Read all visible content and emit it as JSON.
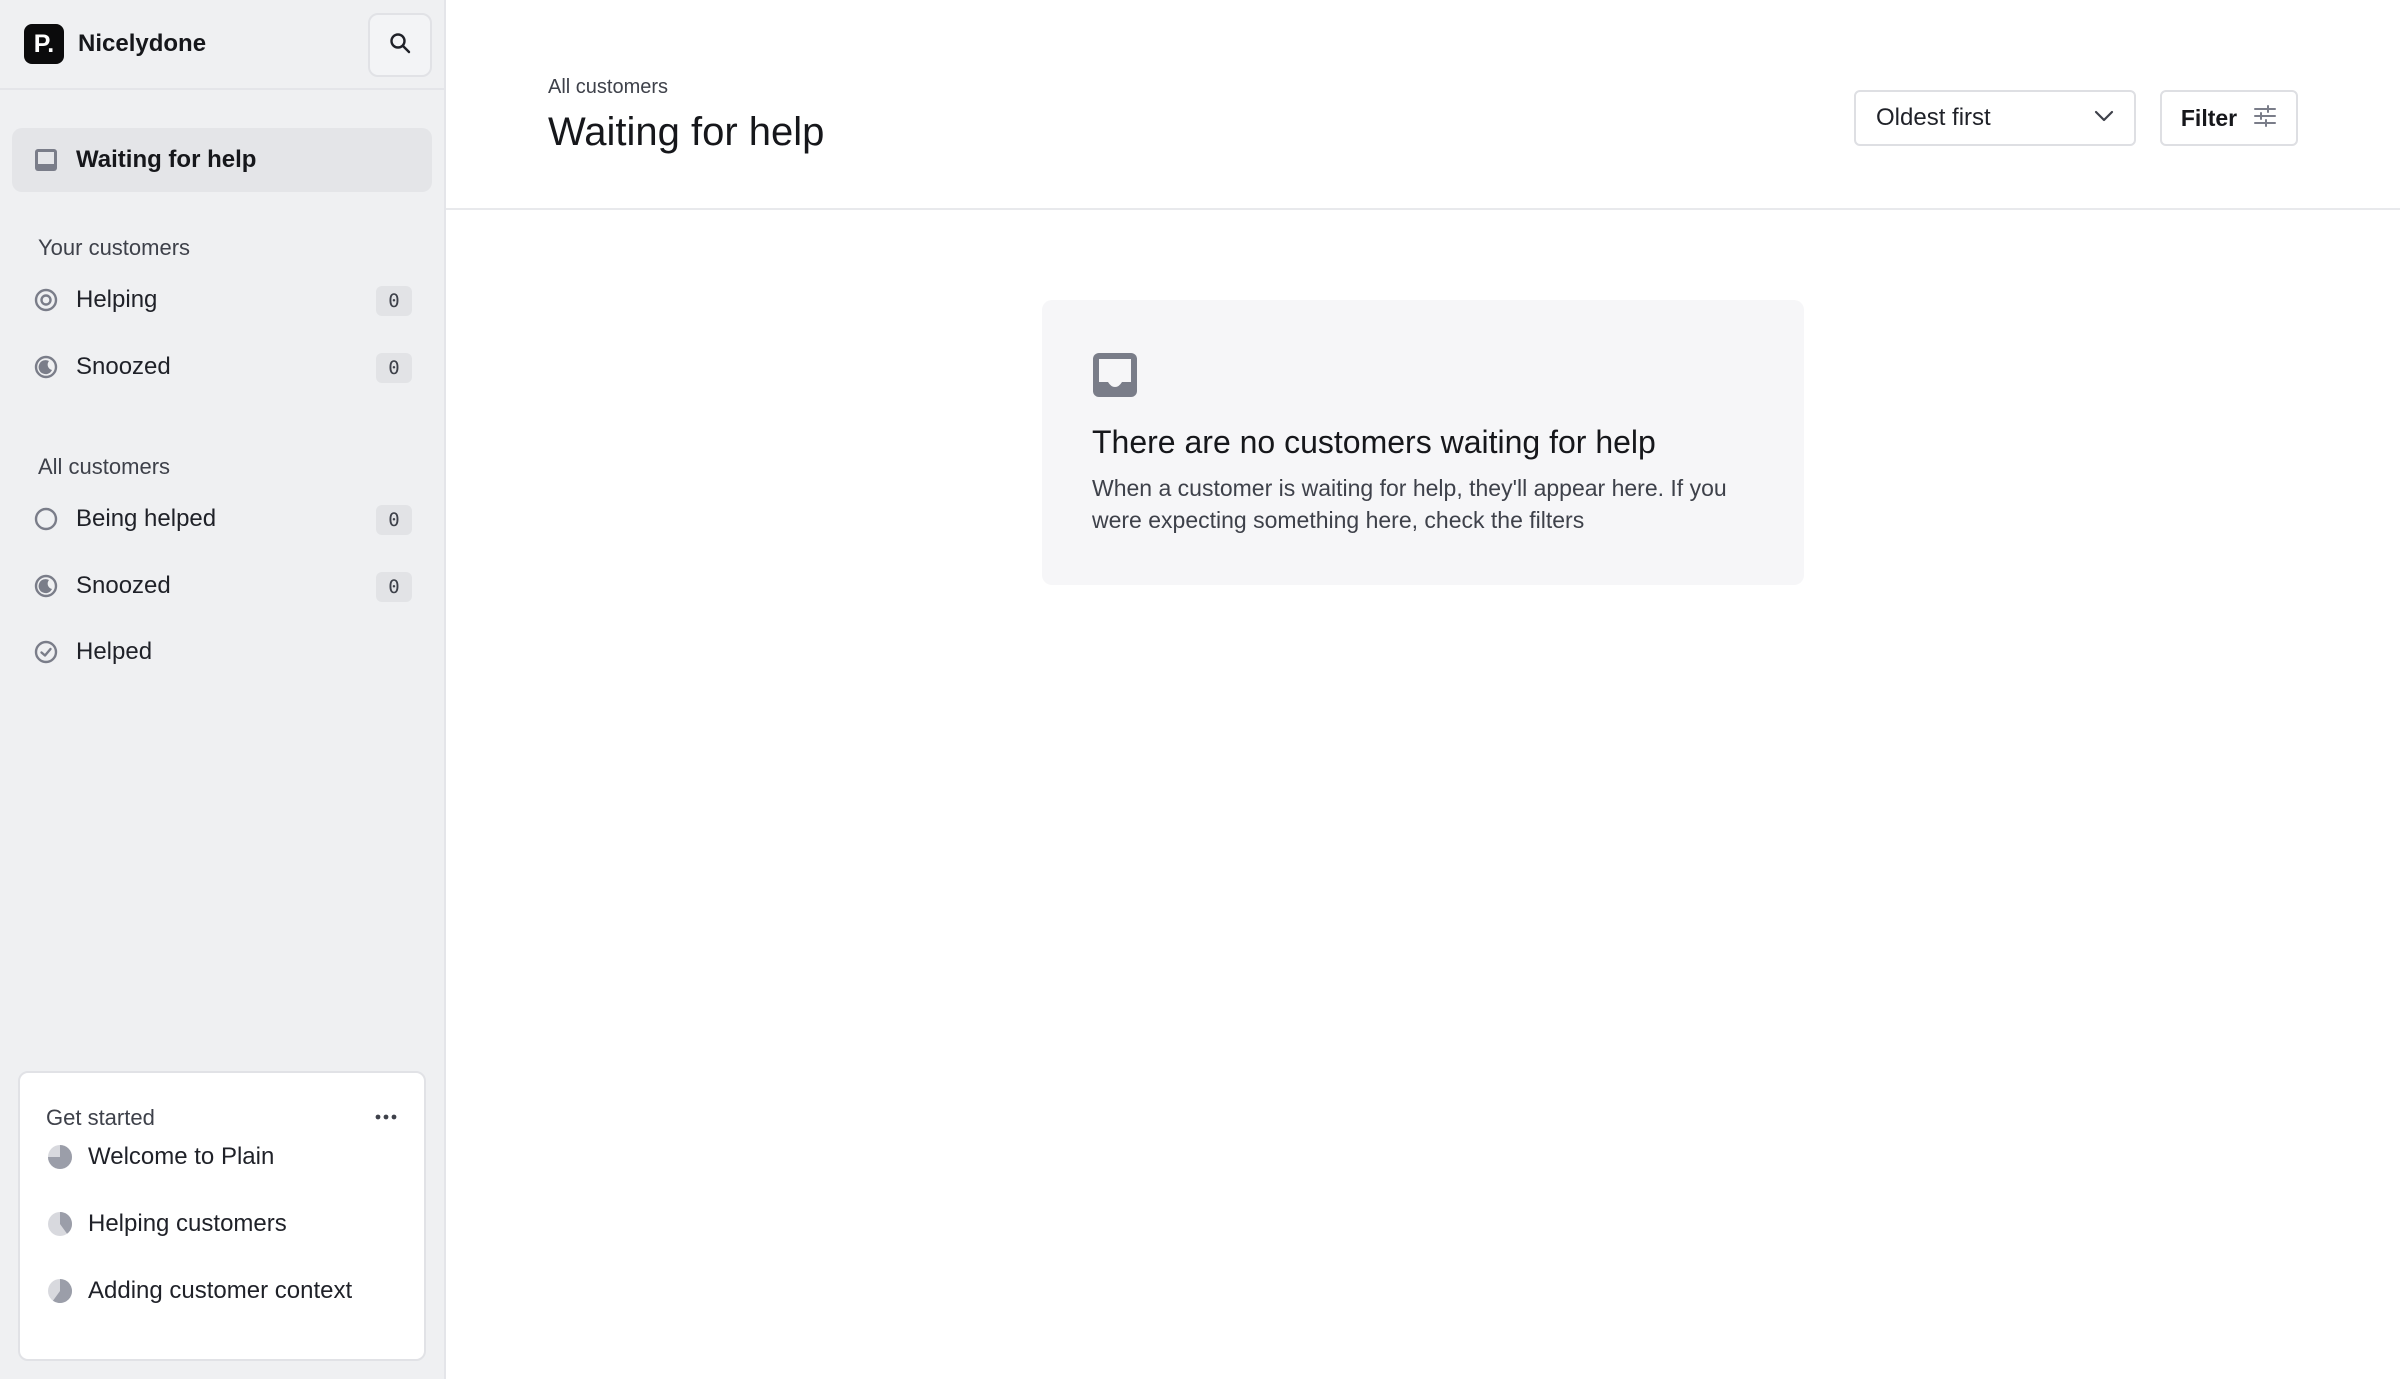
{
  "workspace": {
    "logo_letter": "P.",
    "name": "Nicelydone"
  },
  "sidebar": {
    "main_item": {
      "label": "Waiting for help",
      "icon": "inbox-icon"
    },
    "your_customers": {
      "title": "Your customers",
      "items": [
        {
          "label": "Helping",
          "count": "0",
          "icon": "target-icon"
        },
        {
          "label": "Snoozed",
          "count": "0",
          "icon": "moon-icon"
        }
      ]
    },
    "all_customers": {
      "title": "All customers",
      "items": [
        {
          "label": "Being helped",
          "count": "0",
          "icon": "circle-icon"
        },
        {
          "label": "Snoozed",
          "count": "0",
          "icon": "moon-icon"
        },
        {
          "label": "Helped",
          "icon": "check-circle-icon"
        }
      ]
    },
    "get_started": {
      "title": "Get started",
      "items": [
        {
          "label": "Welcome to Plain",
          "progress": 0.75
        },
        {
          "label": "Helping customers",
          "progress": 0.4
        },
        {
          "label": "Adding customer context",
          "progress": 0.6
        }
      ]
    }
  },
  "header": {
    "breadcrumb": "All customers",
    "title": "Waiting for help",
    "sort": {
      "selected": "Oldest first"
    },
    "filter_label": "Filter"
  },
  "empty_state": {
    "title": "There are no customers waiting for help",
    "description": "When a customer is waiting for help, they'll appear here. If you were expecting something here, check the filters"
  },
  "colors": {
    "sidebar_bg": "#eff0f2",
    "icon_gray": "#7a7d89",
    "text_primary": "#16171b"
  }
}
